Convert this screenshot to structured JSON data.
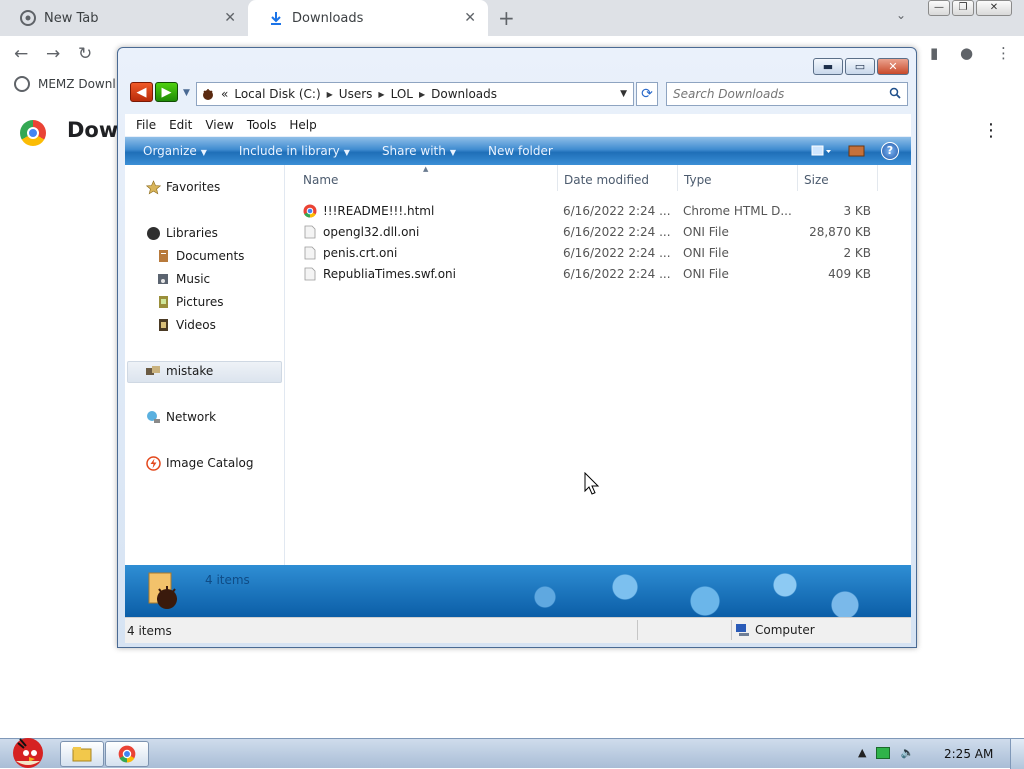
{
  "browser": {
    "tabs": [
      {
        "label": "New Tab",
        "active": false
      },
      {
        "label": "Downloads",
        "active": true
      }
    ],
    "bookmark": "MEMZ Downl",
    "address_hint": "Chrome",
    "page_title": "Down"
  },
  "explorer": {
    "breadcrumb": [
      "Local Disk (C:)",
      "Users",
      "LOL",
      "Downloads"
    ],
    "breadcrumb_prefix": "«",
    "search_placeholder": "Search Downloads",
    "menu": [
      "File",
      "Edit",
      "View",
      "Tools",
      "Help"
    ],
    "commands": [
      "Organize",
      "Include in library",
      "Share with",
      "New folder"
    ],
    "nav": {
      "favorites": "Favorites",
      "libraries": "Libraries",
      "library_items": [
        "Documents",
        "Music",
        "Pictures",
        "Videos"
      ],
      "homegroup": "mistake",
      "network": "Network",
      "catalog": "Image Catalog"
    },
    "columns": [
      "Name",
      "Date modified",
      "Type",
      "Size"
    ],
    "files": [
      {
        "name": "!!!README!!!.html",
        "date": "6/16/2022 2:24 ...",
        "type": "Chrome HTML D...",
        "size": "3 KB",
        "icon": "chrome-icon"
      },
      {
        "name": "opengl32.dll.oni",
        "date": "6/16/2022 2:24 ...",
        "type": "ONI File",
        "size": "28,870 KB",
        "icon": "file-icon"
      },
      {
        "name": "penis.crt.oni",
        "date": "6/16/2022 2:24 ...",
        "type": "ONI File",
        "size": "2 KB",
        "icon": "file-icon"
      },
      {
        "name": "RepubliaTimes.swf.oni",
        "date": "6/16/2022 2:24 ...",
        "type": "ONI File",
        "size": "409 KB",
        "icon": "file-icon"
      }
    ],
    "details_count": "4 items",
    "status_left": "4 items",
    "status_right": "Computer"
  },
  "taskbar": {
    "clock": "2:25 AM"
  },
  "colors": {
    "accent": "#1f6fb8",
    "chrome_tabbar": "#dee1e6",
    "taskbar": "#a9bdd6"
  }
}
